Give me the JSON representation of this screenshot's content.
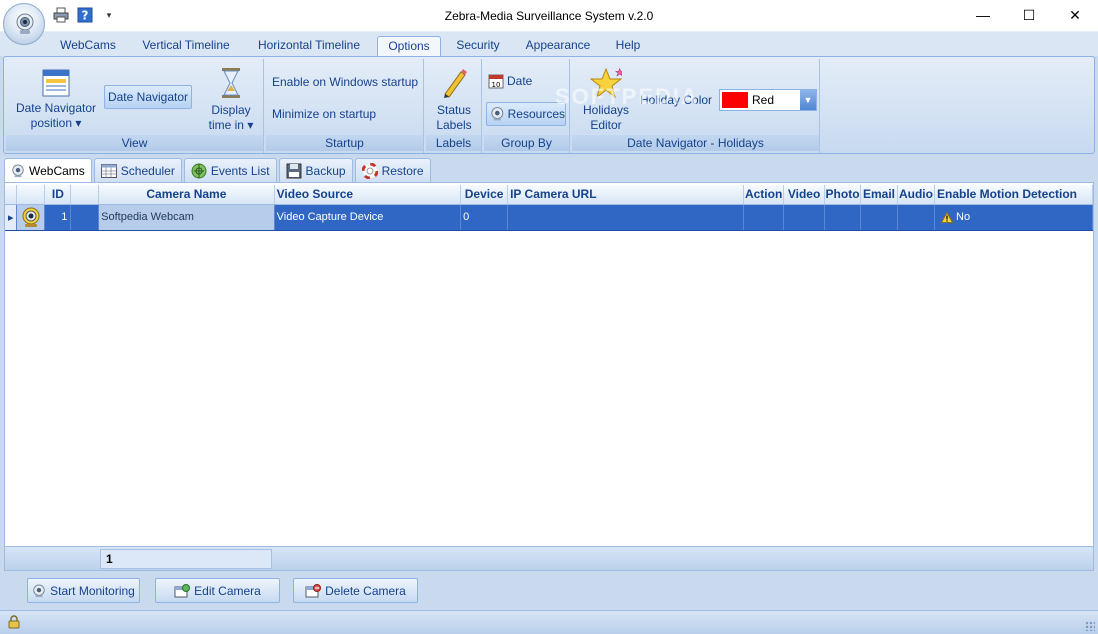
{
  "window": {
    "title": "Zebra-Media Surveillance System v.2.0",
    "controls": {
      "minimize": "—",
      "maximize": "☐",
      "close": "✕"
    }
  },
  "ribbon_tabs": [
    "WebCams",
    "Vertical Timeline",
    "Horizontal Timeline",
    "Options",
    "Security",
    "Appearance",
    "Help"
  ],
  "active_tab": "Options",
  "groups": {
    "view": {
      "label": "View",
      "date_nav_position_1": "Date Navigator",
      "date_nav_position_2": "position ▾",
      "date_navigator": "Date Navigator",
      "display_time_1": "Display",
      "display_time_2": "time in ▾"
    },
    "startup": {
      "label": "Startup",
      "enable_windows": "Enable on Windows startup",
      "minimize": "Minimize on startup"
    },
    "labels": {
      "label": "Labels",
      "status_1": "Status",
      "status_2": "Labels"
    },
    "group_by": {
      "label": "Group By",
      "date": "Date",
      "resources": "Resources"
    },
    "holidays": {
      "label": "Date Navigator - Holidays",
      "editor_1": "Holidays",
      "editor_2": "Editor",
      "holiday_color_label": "Holiday Color",
      "holiday_color_value": "Red",
      "holiday_color_hex": "#ff0000"
    }
  },
  "watermark": "SOFTPEDIA",
  "sub_tabs": [
    "WebCams",
    "Scheduler",
    "Events List",
    "Backup",
    "Restore"
  ],
  "active_sub_tab": "WebCams",
  "table": {
    "columns": [
      "ID",
      "Camera Name",
      "Video Source",
      "Device",
      "IP Camera URL",
      "Action",
      "Video",
      "Photo",
      "Email",
      "Audio",
      "Enable Motion Detection"
    ],
    "rows": [
      {
        "id": "1",
        "camera_name": "Softpedia Webcam",
        "video_source": "Video Capture Device",
        "device": "0",
        "ip_camera_url": "",
        "action": "",
        "video": "",
        "photo": "",
        "email": "",
        "audio": "",
        "motion_detection": "No"
      }
    ],
    "footer_count": "1"
  },
  "buttons": {
    "start_monitoring": "Start Monitoring",
    "edit_camera": "Edit Camera",
    "delete_camera": "Delete Camera"
  }
}
